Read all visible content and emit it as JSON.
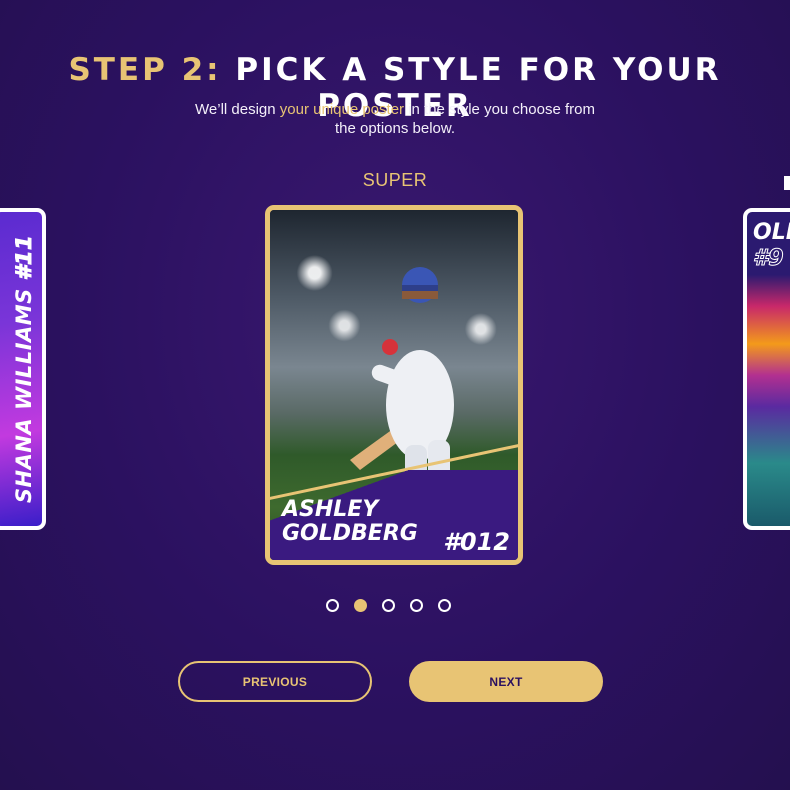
{
  "header": {
    "step_label": "STEP 2:",
    "title": "PICK A STYLE FOR YOUR POSTER"
  },
  "subtitle": {
    "before": "We’ll design ",
    "highlight": "your unique poster",
    "after": " in the style you choose from the options below."
  },
  "carousel": {
    "current_style": "SUPER",
    "cards": [
      {
        "name": "SHANA WILLIAMS",
        "number": "#11"
      },
      {
        "name_line1": "ASHLEY",
        "name_line2": "GOLDBERG",
        "number": "#012"
      },
      {
        "name": "OLI",
        "number": "#9"
      }
    ],
    "page_count": 5,
    "active_page": 2
  },
  "buttons": {
    "previous": "PREVIOUS",
    "next": "NEXT"
  },
  "colors": {
    "background": "#2b1160",
    "accent_gold": "#e8c474",
    "white": "#ffffff"
  }
}
